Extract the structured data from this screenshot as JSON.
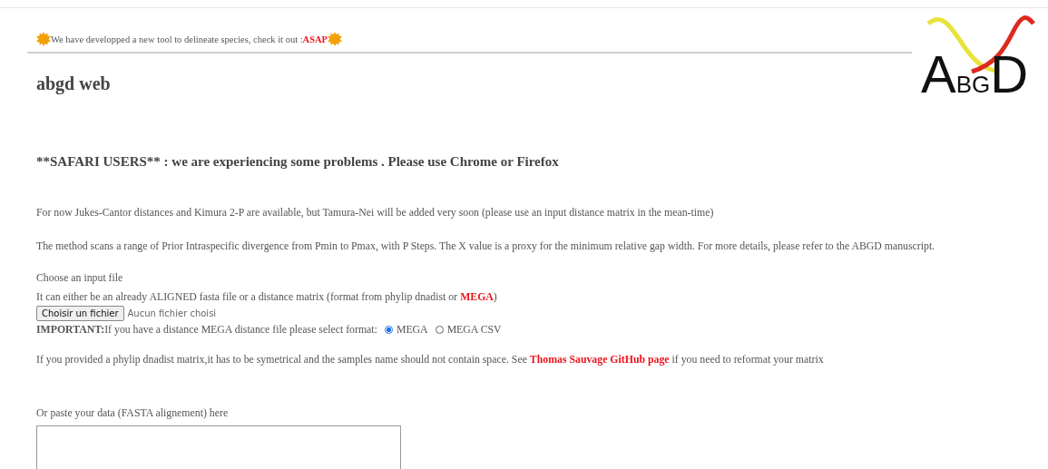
{
  "banner": {
    "text": "We have developped a new tool to delineate species, check it out : ",
    "link": "ASAP"
  },
  "logo": {
    "letters": [
      {
        "text": "A",
        "kind": "big"
      },
      {
        "text": "BG",
        "kind": "small"
      },
      {
        "text": "D",
        "kind": "big"
      }
    ]
  },
  "title": "abgd web",
  "warning": "**SAFARI USERS** : we are experiencing some problems . Please use Chrome or Firefox",
  "notes": [
    "For now Jukes-Cantor distances and Kimura 2-P are available, but Tamura-Nei will be added very soon (please use an input distance matrix in the mean-time)",
    "The method scans a range of Prior Intraspecific divergence from Pmin to Pmax, with P Steps. The X value is a proxy for the minimum relative gap width. For more details, please refer to the ABGD manuscript."
  ],
  "input_file": {
    "label": "Choose an input file",
    "hint": "It can either be an already ALIGNED fasta file or a distance matrix (format from phylip dnadist or ",
    "hint_link": "MEGA",
    "hint_end": ")",
    "button": "Choisir un fichier",
    "status": "Aucun fichier choisi"
  },
  "format": {
    "label_bold": "IMPORTANT:",
    "label": "If you have a distance MEGA distance file please select format:",
    "options": [
      {
        "label": "MEGA",
        "selected": true
      },
      {
        "label": "MEGA CSV",
        "selected": false
      }
    ]
  },
  "phylip_note": {
    "text": "If you provided a phylip dnadist matrix,it has to be symetrical and the samples name should not contain space. See ",
    "link": "Thomas Sauvage GitHub page",
    "end": " if you need to reformat your matrix"
  },
  "paste": {
    "label": "Or paste your data (FASTA alignement) here"
  }
}
